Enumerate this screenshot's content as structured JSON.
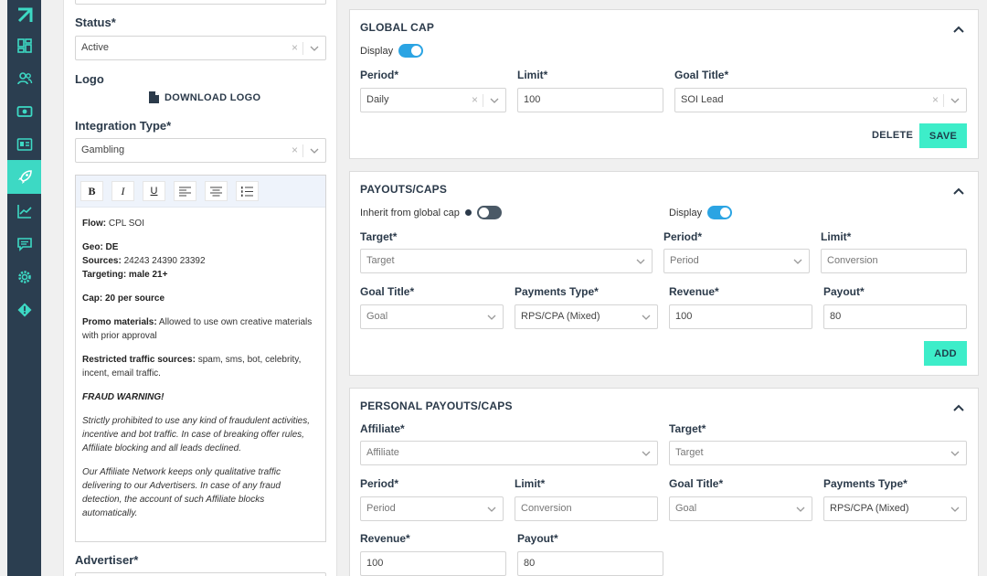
{
  "sidebar": {
    "items": [
      {
        "icon": "logo-arrow-icon",
        "active": false
      },
      {
        "icon": "dashboard-icon",
        "active": false
      },
      {
        "icon": "users-icon",
        "active": false
      },
      {
        "icon": "money-icon",
        "active": false
      },
      {
        "icon": "id-card-icon",
        "active": false
      },
      {
        "icon": "rocket-icon",
        "active": true
      },
      {
        "icon": "chart-line-icon",
        "active": false
      },
      {
        "icon": "chat-icon",
        "active": false
      },
      {
        "icon": "gear-icon",
        "active": false
      },
      {
        "icon": "alert-icon",
        "active": false
      }
    ],
    "accent": "#3dd9c4",
    "bg": "#2b3e50"
  },
  "left": {
    "status_label": "Status*",
    "status_value": "Active",
    "logo_label": "Logo",
    "download_logo": "DOWNLOAD LOGO",
    "integration_label": "Integration Type*",
    "integration_value": "Gambling",
    "editor": {
      "toolbar": [
        "B",
        "I",
        "U"
      ],
      "flow_label": "Flow:",
      "flow_value": " CPL SOI",
      "geo_label": "Geo:",
      "geo_value": " DE",
      "sources_label": "Sources:",
      "sources_value": " 24243 24390 23392",
      "targeting": "Targeting: male 21+",
      "cap": "Cap: 20 per source",
      "promo_label": "Promo materials:",
      "promo_value": " Allowed to use own creative materials with prior approval",
      "restricted_label": "Restricted traffic sources:",
      "restricted_value": " spam, sms, bot, celebrity, incent, email traffic.",
      "fraud_title": "FRAUD WARNING!",
      "fraud_text": "Strictly prohibited to use any kind of fraudulent activities, incentive and bot traffic. In case of breaking offer rules, Affiliate blocking and all leads declined.",
      "network_text": "Our Affiliate Network keeps only qualitative traffic delivering to our Advertisers. In case of any fraud detection, the account of such Affiliate blocks automatically."
    },
    "advertiser_label": "Advertiser*"
  },
  "global_cap": {
    "title": "GLOBAL CAP",
    "display_label": "Display",
    "period_label": "Period*",
    "period_value": "Daily",
    "limit_label": "Limit*",
    "limit_value": "100",
    "goal_label": "Goal Title*",
    "goal_value": "SOI Lead",
    "delete_label": "DELETE",
    "save_label": "SAVE"
  },
  "payouts": {
    "title": "PAYOUTS/CAPS",
    "inherit_label": "Inherit from global cap",
    "display_label": "Display",
    "target_label": "Target*",
    "target_ph": "Target",
    "period_label": "Period*",
    "period_ph": "Period",
    "limit_label": "Limit*",
    "limit_ph": "Conversion",
    "goal_label": "Goal Title*",
    "goal_ph": "Goal",
    "ptype_label": "Payments Type*",
    "ptype_value": "RPS/CPA (Mixed)",
    "revenue_label": "Revenue*",
    "revenue_value": "100",
    "payout_label": "Payout*",
    "payout_value": "80",
    "add_label": "ADD"
  },
  "personal": {
    "title": "PERSONAL PAYOUTS/CAPS",
    "affiliate_label": "Affiliate*",
    "affiliate_ph": "Affiliate",
    "target_label": "Target*",
    "target_ph": "Target",
    "period_label": "Period*",
    "period_ph": "Period",
    "limit_label": "Limit*",
    "limit_ph": "Conversion",
    "goal_label": "Goal Title*",
    "goal_ph": "Goal",
    "ptype_label": "Payments Type*",
    "ptype_value": "RPS/CPA (Mixed)",
    "revenue_label": "Revenue*",
    "revenue_value": "100",
    "payout_label": "Payout*",
    "payout_value": "80"
  }
}
